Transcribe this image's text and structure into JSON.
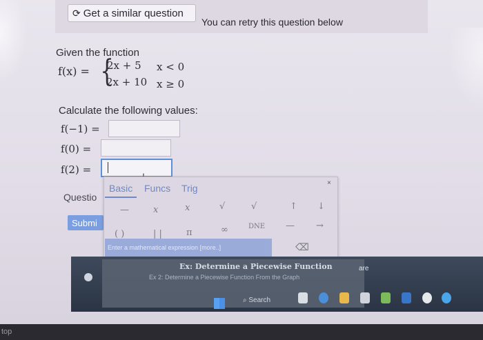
{
  "header": {
    "similar_button_label": "Get a similar question",
    "retry_text": "You can retry this question below"
  },
  "question": {
    "given_text": "Given the function",
    "function_lhs": "f(x) =",
    "cases": [
      {
        "expr": "2x + 5",
        "cond": "x < 0"
      },
      {
        "expr": "2x + 10",
        "cond": "x ≥ 0"
      }
    ],
    "calc_text": "Calculate the following values:",
    "items": [
      {
        "label": "f(−1) =",
        "value": ""
      },
      {
        "label": "f(0) =",
        "value": ""
      },
      {
        "label": "f(2) =",
        "value": ""
      }
    ],
    "question_label": "Questio",
    "submit_label": "Submi"
  },
  "palette": {
    "tabs": [
      "Basic",
      "Funcs",
      "Trig"
    ],
    "active_tab": "Basic",
    "row1": [
      "—",
      "x",
      "x",
      "√",
      "√",
      "↑",
      "↓"
    ],
    "row2": [
      "( )",
      "| |",
      "π",
      "∞",
      "DNE",
      "—",
      "→"
    ],
    "hint": "Enter a mathematical expression [more..]",
    "close": "×",
    "backspace": "⌫"
  },
  "taskbar": {
    "video_title": "Ex: Determine a Piecewise Function",
    "video_sub": "Ex 2: Determine a Piecewise Function From the Graph",
    "search_label": "Search",
    "share_label": "are"
  },
  "bezel": {
    "label": "top"
  },
  "icons": {
    "refresh": "refresh-icon",
    "start": "windows-start-icon",
    "search": "search-icon",
    "backspace": "backspace-icon",
    "close": "close-icon"
  },
  "colors": {
    "accent": "#6e88c8",
    "submit": "#7b9ee0",
    "focus_border": "#5c8fd3"
  }
}
